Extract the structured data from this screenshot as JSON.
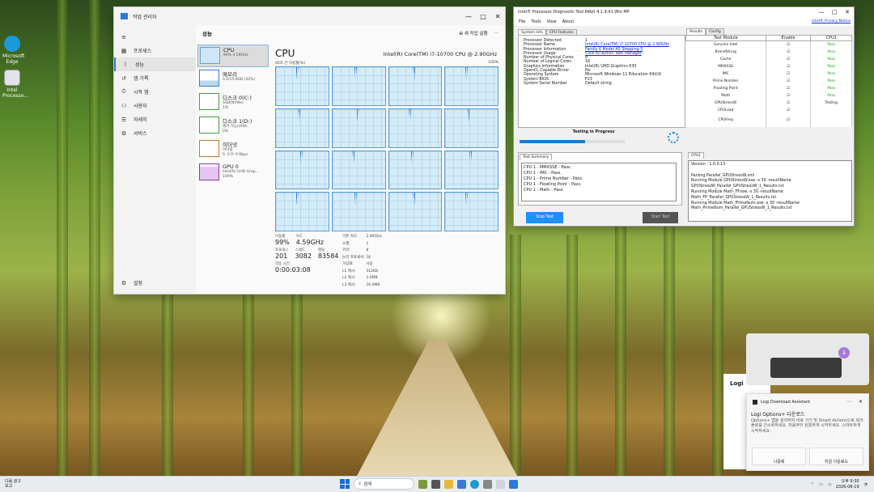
{
  "desktop": {
    "icons": [
      {
        "label": "Microsoft Edge",
        "icon": "edge-icon",
        "color": "#1a9ad6"
      },
      {
        "label": "Intel Processo...",
        "icon": "document-icon",
        "color": "#e0e4ea"
      }
    ]
  },
  "task_manager": {
    "title": "작업 관리자",
    "nav": [
      {
        "label": "프로세스",
        "icon": "grid-icon"
      },
      {
        "label": "성능",
        "icon": "performance-icon",
        "selected": true
      },
      {
        "label": "앱 기록",
        "icon": "history-icon"
      },
      {
        "label": "시작 앱",
        "icon": "startup-icon"
      },
      {
        "label": "사용자",
        "icon": "users-icon"
      },
      {
        "label": "자세히",
        "icon": "details-icon"
      },
      {
        "label": "서비스",
        "icon": "services-icon"
      }
    ],
    "settings_label": "설정",
    "page_title": "성능",
    "run_task_label": "새 작업 실행",
    "resources": [
      {
        "name": "CPU",
        "value": "99% 4.59GHz"
      },
      {
        "name": "메모리",
        "value": "5.0/15.8GB (32%)"
      },
      {
        "name": "디스크 0(C:)",
        "value": "SSD(NVMe)",
        "value2": "1%"
      },
      {
        "name": "디스크 1(D:)",
        "value": "제거 가능(USB)",
        "value2": "0%"
      },
      {
        "name": "이더넷",
        "value": "이더넷",
        "value2": "S: 0 R: 0 Kbps"
      },
      {
        "name": "GPU 0",
        "value": "Intel(R) UHD Grap...",
        "value2": "100%"
      }
    ],
    "cpu": {
      "title": "CPU",
      "model": "Intel(R) Core(TM) i7-10700 CPU @ 2.90GHz",
      "graph_label": "60초 간 이용률(%)",
      "graph_max": "100%",
      "utilization_label": "이용률",
      "utilization": "99%",
      "speed_label": "속도",
      "speed": "4.59GHz",
      "processes_label": "프로세스",
      "processes": "201",
      "threads_label": "스레드",
      "threads": "3082",
      "handles_label": "핸들",
      "handles": "83584",
      "uptime_label": "작동 시간",
      "uptime": "0:00:03:08",
      "specs": [
        {
          "k": "기본 속도:",
          "v": "2.90GHz"
        },
        {
          "k": "소켓:",
          "v": "1"
        },
        {
          "k": "코어:",
          "v": "8"
        },
        {
          "k": "논리 프로세서:",
          "v": "16"
        },
        {
          "k": "가상화:",
          "v": "사용"
        },
        {
          "k": "L1 캐시:",
          "v": "512KB"
        },
        {
          "k": "L2 캐시:",
          "v": "2.0MB"
        },
        {
          "k": "L3 캐시:",
          "v": "16.0MB"
        }
      ]
    }
  },
  "ipdt": {
    "title": "Intel® Processor Diagnostic Tool 64bit 4.1.9.41 Win MP",
    "menu": [
      "File",
      "Tools",
      "View",
      "About"
    ],
    "privacy_link": "Intel® Privacy Notice",
    "left_tabs": [
      "System Info",
      "CPU Features"
    ],
    "system_info": [
      {
        "k": "Processor Detected",
        "v": "1"
      },
      {
        "k": "Processor Name",
        "v": "Intel(R) Core(TM) i7-10700 CPU @ 2.90GHz",
        "link": true
      },
      {
        "k": "Processor Information",
        "v": "Family 6 Model A5 Stepping 5",
        "link": true
      },
      {
        "k": "Processor Usage",
        "v": "Click to launch Task Manager",
        "link": true
      },
      {
        "k": "Number of Physical Cores",
        "v": "8"
      },
      {
        "k": "Number of Logical Cores",
        "v": "16"
      },
      {
        "k": "Graphics Information",
        "v": "Intel(R) UHD Graphics 630"
      },
      {
        "k": "OpenCL Capable Driver",
        "v": "No"
      },
      {
        "k": "Operating System",
        "v": "Microsoft Windows 11 Education 64비트"
      },
      {
        "k": "System BIOS",
        "v": "F23"
      },
      {
        "k": "System Serial Number",
        "v": "Default string"
      }
    ],
    "status": "Testing in Progress",
    "progress": 0.62,
    "summary_tab": "Test Summary",
    "summary_log": [
      "CPU 1 - MMXSSE - Pass.",
      "CPU 1 - IMC - Pass.",
      "CPU 1 - Prime Number - Pass.",
      "CPU 1 - Floating Point - Pass.",
      "CPU 1 - Math - Pass."
    ],
    "stop_label": "Stop Test",
    "start_label": "Start Test",
    "right_tabs": [
      "Results",
      "Config"
    ],
    "results_headers": [
      "Test Module",
      "Enable",
      "CPU1"
    ],
    "results": [
      {
        "module": "Genuine Intel",
        "enable": "☑",
        "cpu1": "Pass"
      },
      {
        "module": "BrandString",
        "enable": "☑",
        "cpu1": "Pass"
      },
      {
        "module": "Cache",
        "enable": "☑",
        "cpu1": "Pass"
      },
      {
        "module": "MMXSSE",
        "enable": "☑",
        "cpu1": "Pass"
      },
      {
        "module": "IMC",
        "enable": "☑",
        "cpu1": "Pass"
      },
      {
        "module": "Prime Number",
        "enable": "☑",
        "cpu1": "Pass"
      },
      {
        "module": "Floating Point",
        "enable": "☑",
        "cpu1": "Pass"
      },
      {
        "module": "Math",
        "enable": "☑",
        "cpu1": "Pass"
      },
      {
        "module": "GPUStressW",
        "enable": "☑",
        "cpu1": "Testing"
      },
      {
        "module": "CPULoad",
        "enable": "☑",
        "cpu1": ""
      },
      {
        "module": "CPUFreq",
        "enable": "☑",
        "cpu1": ""
      }
    ],
    "cpu1_tab": "CPU1",
    "cpu1_log": [
      "Version - 1.0.0.13",
      "",
      "Parsing Parallel_GPUStressW.xml",
      "Running Module GPUStressW.exe -s 30 -resultName",
      "GPUStressW_Parallel_GPUStressW_1_Results.txt",
      "Running Module Math_FP.exe -s 30 -resultName",
      "Math_FP_Parallel_GPUStressW_1_Results.txt",
      "Running Module Math_PrimeNum.exe -s 30 -resultName",
      "Math_PrimeNum_Parallel_GPUStressW_1_Results.txt"
    ]
  },
  "logi": {
    "behind_title": "Logi",
    "app_name": "Logi Download Assistant",
    "title": "Logi Options+ 다운로드",
    "message": "Options+ 앱을 설치하여 바로 가기 및 Smart Actions으로 워크플로를 간소화하세요. 처음부터 원활하게 시작하세요. 스마트하게 시작하세요.",
    "later_label": "나중에",
    "download_label": "지금 다운로드"
  },
  "taskbar": {
    "weather_title": "다음 광고",
    "weather_sub": "보고",
    "search_placeholder": "검색",
    "time": "오후 9:30",
    "date": "2026-08-19"
  }
}
